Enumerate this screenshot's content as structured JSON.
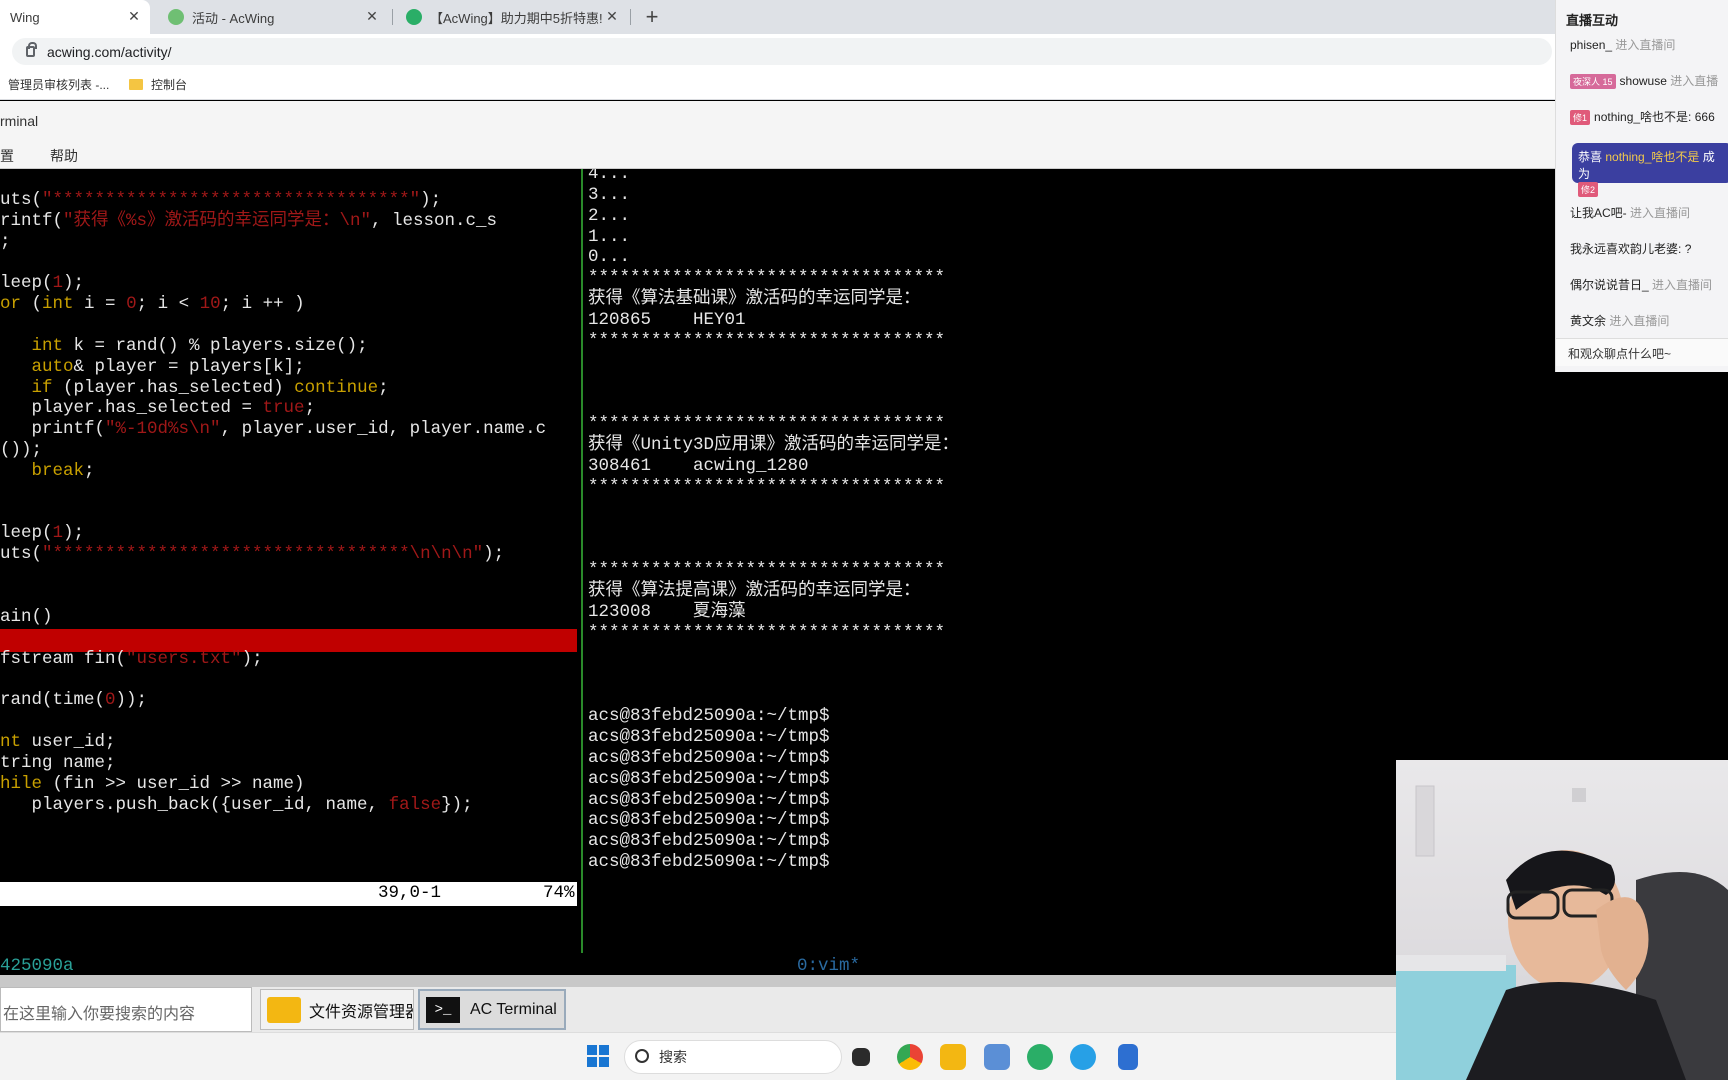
{
  "browser": {
    "tabs": [
      {
        "title": "Wing",
        "active": true
      },
      {
        "title": "活动 - AcWing",
        "active": false
      },
      {
        "title": "【AcWing】助力期中5折特惠!",
        "active": false
      }
    ],
    "new_tab": "+",
    "close_glyph": "✕",
    "url": "acwing.com/activity/",
    "bookmarks": [
      "管理员审核列表 -...",
      "控制台"
    ]
  },
  "app": {
    "title": "rminal",
    "menu": [
      "置",
      "帮助"
    ]
  },
  "vim_left": [
    {
      "t": "",
      "r": ""
    },
    {
      "t": "uts(",
      "r": "\"**********************************\"",
      "e": ");"
    },
    {
      "t": "rintf(",
      "r": "\"获得《%s》激活码的幸运同学是：\\n\"",
      "e": ", lesson.c_s"
    },
    {
      "t": ";",
      "r": ""
    },
    {
      "t": "",
      "r": ""
    },
    {
      "t": "leep(",
      "r": "1",
      "e": ");"
    },
    {
      "k": "or",
      "t": " (",
      "k2": "int",
      "t2": " i = ",
      "r": "0",
      "e": "; i < ",
      "r2": "10",
      "e2": "; i ++ )"
    },
    {
      "t": "",
      "r": ""
    },
    {
      "t": "   ",
      "k": "int",
      "t2": " k = rand() % players.size();"
    },
    {
      "t": "   ",
      "k": "auto",
      "t2": "& player = players[k];"
    },
    {
      "t": "   ",
      "k": "if",
      "t2": " (player.has_selected) ",
      "k2": "continue",
      "e": ";"
    },
    {
      "t": "   player.has_selected = ",
      "r": "true",
      "e": ";"
    },
    {
      "t": "   printf(",
      "r": "\"%-10d%s\\n\"",
      "e": ", player.user_id, player.name.c"
    },
    {
      "t": "());",
      "r": ""
    },
    {
      "t": "   ",
      "k": "break",
      "e": ";"
    },
    {
      "t": "",
      "r": ""
    },
    {
      "t": "",
      "r": ""
    },
    {
      "t": "leep(",
      "r": "1",
      "e": ");"
    },
    {
      "t": "uts(",
      "r": "\"**********************************\\n\\n\\n\"",
      "e": ");"
    },
    {
      "t": "",
      "r": ""
    },
    {
      "t": "",
      "r": ""
    },
    {
      "t": "ain()",
      "r": ""
    },
    {
      "t": "",
      "r": ""
    },
    {
      "t": "fstream fin(",
      "r": "\"users.txt\"",
      "e": ");"
    },
    {
      "t": "",
      "r": ""
    },
    {
      "t": "rand(time(",
      "r": "0",
      "e": "));"
    },
    {
      "t": "",
      "r": ""
    },
    {
      "k": "nt",
      "t": " user_id;"
    },
    {
      "t": "tring name;"
    },
    {
      "k": "hile",
      "t": " (fin >> user_id >> name)"
    },
    {
      "t": "   players.push_back({user_id, name, ",
      "r": "false",
      "e": "});"
    }
  ],
  "vim_status": {
    "position": "39,0-1",
    "percent": "74%"
  },
  "terminal_right": [
    "4...",
    "3...",
    "2...",
    "1...",
    "0...",
    "**********************************",
    "获得《算法基础课》激活码的幸运同学是：",
    "120865    HEY01",
    "**********************************",
    "",
    "",
    "",
    "**********************************",
    "获得《Unity3D应用课》激活码的幸运同学是：",
    "308461    acwing_1280",
    "**********************************",
    "",
    "",
    "",
    "**********************************",
    "获得《算法提高课》激活码的幸运同学是：",
    "123008    夏海藻",
    "**********************************",
    "",
    "",
    "",
    "acs@83febd25090a:~/tmp$",
    "acs@83febd25090a:~/tmp$",
    "acs@83febd25090a:~/tmp$",
    "acs@83febd25090a:~/tmp$",
    "acs@83febd25090a:~/tmp$",
    "acs@83febd25090a:~/tmp$",
    "acs@83febd25090a:~/tmp$",
    "acs@83febd25090a:~/tmp$"
  ],
  "tmux": {
    "host": "425090a",
    "window": "0:vim*"
  },
  "taskbar": {
    "search_placeholder": "在这里输入你要搜索的内容",
    "files": "文件资源管理器",
    "terminal": "AC Terminal",
    "win_search": "搜索"
  },
  "live": {
    "title": "直播互动",
    "rows": [
      {
        "name": "phisen_",
        "action": "进入直播间"
      },
      {
        "badge": "夜深人 15",
        "name": "showuse",
        "action": "进入直播"
      },
      {
        "badge": "修1",
        "name": "nothing_啥也不是:",
        "action": "666"
      },
      {
        "name": "让我AC吧-",
        "action": "进入直播间"
      },
      {
        "name": "我永远喜欢韵儿老婆:",
        "action": "?"
      },
      {
        "name": "偶尔说说昔日_",
        "action": "进入直播间"
      },
      {
        "name": "黄文余",
        "action": "进入直播间"
      }
    ],
    "gift_prefix": "恭喜",
    "gift_name": "nothing_啥也不是",
    "gift_suffix": "成为",
    "gift_badge": "修2",
    "chat_placeholder": "和观众聊点什么吧~",
    "colors": {
      "accent": "#3b3fa0",
      "gold": "#f2c94c"
    }
  }
}
